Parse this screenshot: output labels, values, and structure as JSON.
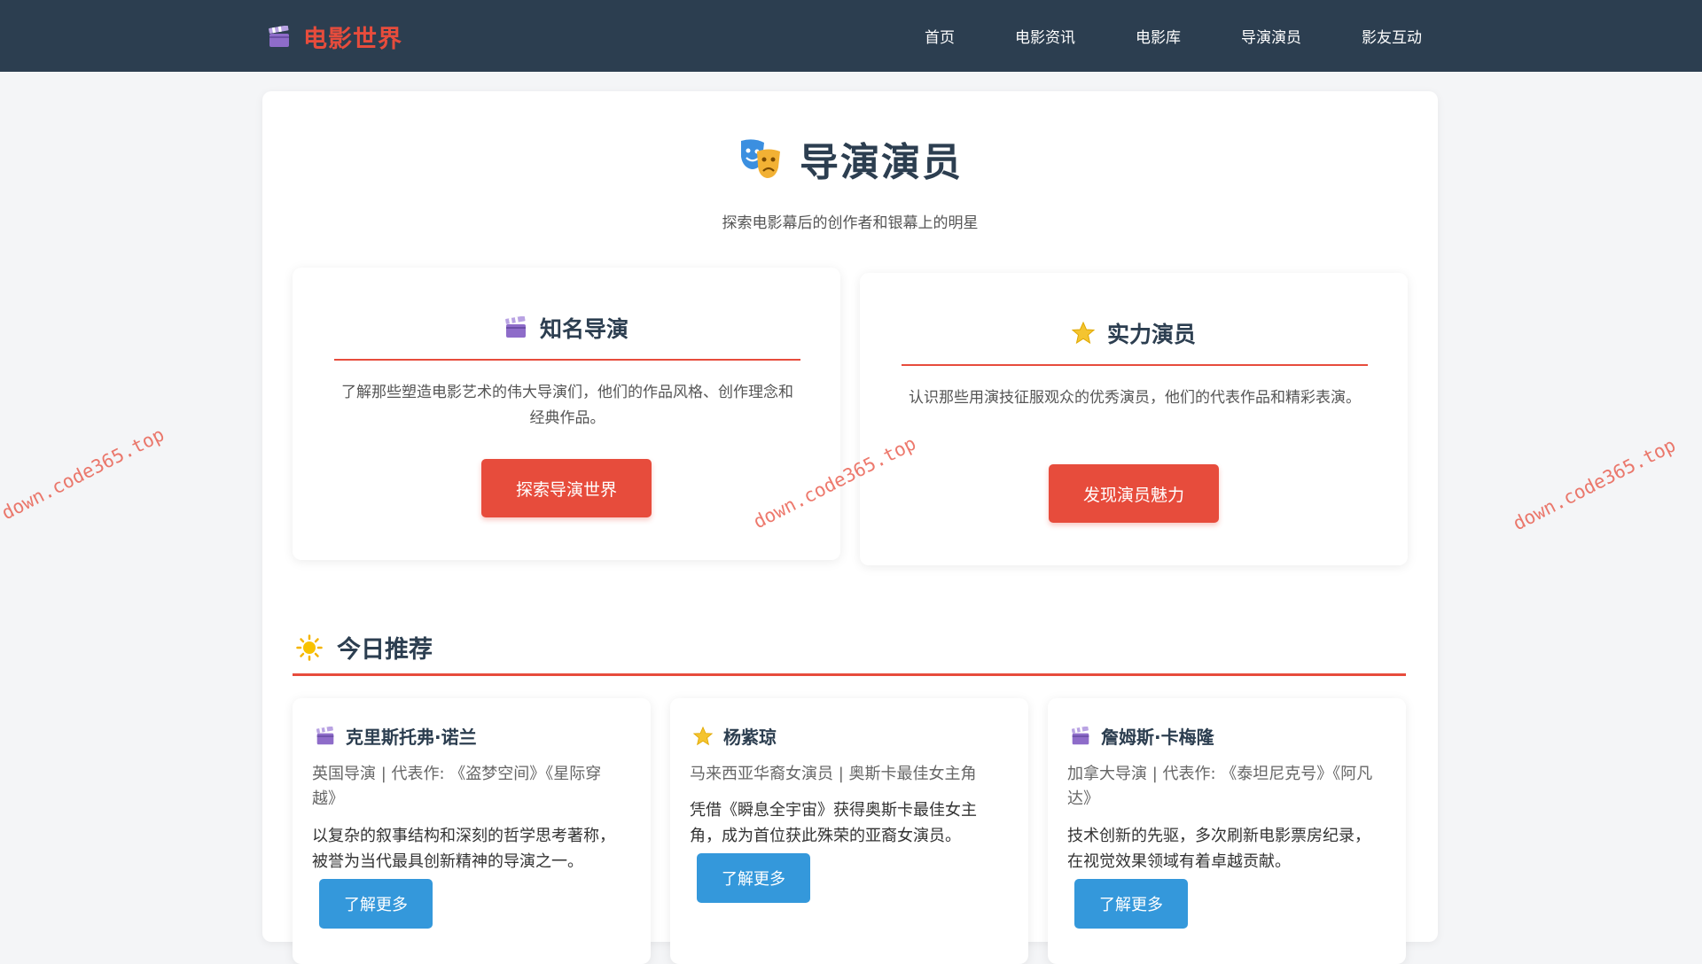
{
  "brand": {
    "name": "电影世界",
    "icon": "clapperboard-icon"
  },
  "nav": {
    "items": [
      {
        "label": "首页"
      },
      {
        "label": "电影资讯"
      },
      {
        "label": "电影库"
      },
      {
        "label": "导演演员"
      },
      {
        "label": "影友互动"
      }
    ]
  },
  "header": {
    "title": "导演演员",
    "subtitle": "探索电影幕后的创作者和银幕上的明星",
    "icon": "theater-masks-icon"
  },
  "features": [
    {
      "title": "知名导演",
      "icon": "clapperboard-icon",
      "description": "了解那些塑造电影艺术的伟大导演们，他们的作品风格、创作理念和经典作品。",
      "button": "探索导演世界"
    },
    {
      "title": "实力演员",
      "icon": "star-icon",
      "description": "认识那些用演技征服观众的优秀演员，他们的代表作品和精彩表演。",
      "button": "发现演员魅力"
    }
  ],
  "today": {
    "title": "今日推荐",
    "icon": "sun-icon",
    "cards": [
      {
        "name": "克里斯托弗·诺兰",
        "icon": "clapperboard-icon",
        "meta": "英国导演 | 代表作: 《盗梦空间》《星际穿越》",
        "description": "以复杂的叙事结构和深刻的哲学思考著称，被誉为当代最具创新精神的导演之一。",
        "button": "了解更多"
      },
      {
        "name": "杨紫琼",
        "icon": "star-icon",
        "meta": "马来西亚华裔女演员 | 奥斯卡最佳女主角",
        "description": "凭借《瞬息全宇宙》获得奥斯卡最佳女主角，成为首位获此殊荣的亚裔女演员。",
        "button": "了解更多"
      },
      {
        "name": "詹姆斯·卡梅隆",
        "icon": "clapperboard-icon",
        "meta": "加拿大导演 | 代表作: 《泰坦尼克号》《阿凡达》",
        "description": "技术创新的先驱，多次刷新电影票房纪录，在视觉效果领域有着卓越贡献。",
        "button": "了解更多"
      }
    ]
  },
  "watermark": "down.code365.top",
  "colors": {
    "navbar": "#2c3e50",
    "accent": "#e74c3c",
    "button_blue": "#3498db",
    "heading": "#2c3e50"
  }
}
